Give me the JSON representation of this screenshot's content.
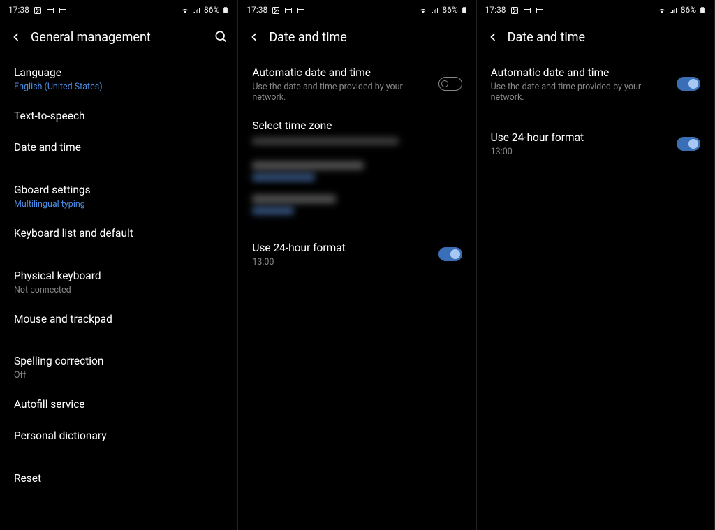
{
  "status": {
    "time": "17:38",
    "battery": "86%"
  },
  "screen1": {
    "title": "General management",
    "items": [
      {
        "title": "Language",
        "sub": "English (United States)",
        "link": true
      },
      {
        "title": "Text-to-speech"
      },
      {
        "title": "Date and time"
      },
      {
        "title": "Gboard settings",
        "sub": "Multilingual typing",
        "link": true
      },
      {
        "title": "Keyboard list and default"
      },
      {
        "title": "Physical keyboard",
        "sub": "Not connected"
      },
      {
        "title": "Mouse and trackpad"
      },
      {
        "title": "Spelling correction",
        "sub": "Off"
      },
      {
        "title": "Autofill service"
      },
      {
        "title": "Personal dictionary"
      },
      {
        "title": "Reset"
      }
    ]
  },
  "screen2": {
    "title": "Date and time",
    "auto": {
      "title": "Automatic date and time",
      "sub": "Use the date and time provided by your network.",
      "on": false
    },
    "zone_heading": "Select time zone",
    "hour24": {
      "title": "Use 24-hour format",
      "sub": "13:00",
      "on": true
    }
  },
  "screen3": {
    "title": "Date and time",
    "auto": {
      "title": "Automatic date and time",
      "sub": "Use the date and time provided by your network.",
      "on": true
    },
    "hour24": {
      "title": "Use 24-hour format",
      "sub": "13:00",
      "on": true
    }
  }
}
